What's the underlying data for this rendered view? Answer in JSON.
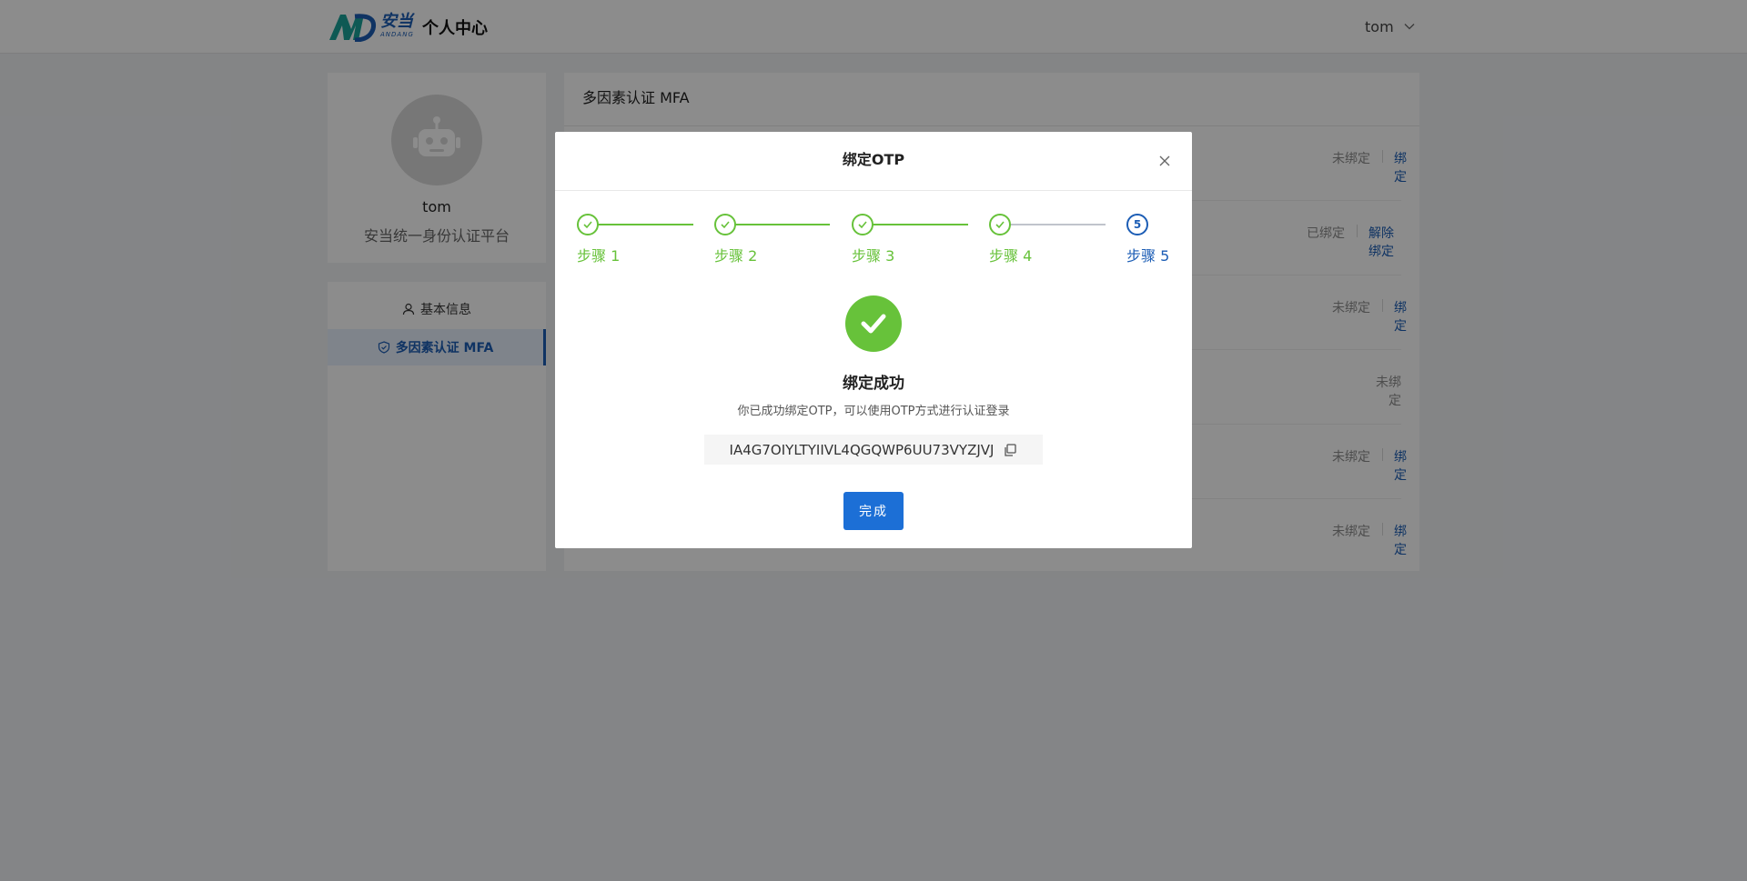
{
  "header": {
    "brand_cn": "安当",
    "brand_en": "ANDANG",
    "title": "个人中心",
    "username": "tom",
    "user_menu_icon": "chevron-down-icon"
  },
  "profile": {
    "name": "tom",
    "subtitle": "安当统一身份认证平台",
    "avatar_icon": "robot-icon"
  },
  "sidebar": {
    "items": [
      {
        "label": "基本信息",
        "icon": "user-icon"
      },
      {
        "label": "多因素认证 MFA",
        "icon": "shield-check-icon"
      }
    ]
  },
  "mfa": {
    "title": "多因素认证 MFA",
    "rows": [
      {
        "status": "未绑定",
        "action": "绑定"
      },
      {
        "status": "已绑定",
        "action": "解除绑定"
      },
      {
        "status": "未绑定",
        "action": "绑定"
      },
      {
        "status": "未绑定",
        "action": ""
      },
      {
        "status": "未绑定",
        "action": "绑定"
      },
      {
        "status": "未绑定",
        "action": "绑定"
      }
    ]
  },
  "modal": {
    "title": "绑定OTP",
    "steps": [
      {
        "label": "步骤 1",
        "state": "done"
      },
      {
        "label": "步骤 2",
        "state": "done"
      },
      {
        "label": "步骤 3",
        "state": "done"
      },
      {
        "label": "步骤 4",
        "state": "done"
      },
      {
        "label": "步骤 5",
        "number": "5",
        "state": "active"
      }
    ],
    "success_title": "绑定成功",
    "success_desc": "你已成功绑定OTP，可以使用OTP方式进行认证登录",
    "secret": "IA4G7OIYLTYIIVL4QGQWP6UU73VYZJVJ",
    "done_label": "完成"
  },
  "colors": {
    "primary": "#1c5db5",
    "success": "#67c23a",
    "overlay": "rgba(0,0,0,0.45)"
  }
}
